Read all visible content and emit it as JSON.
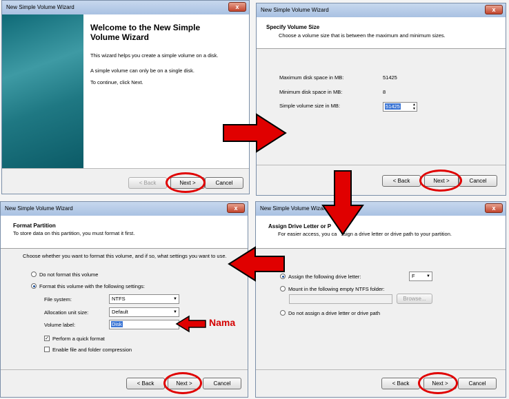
{
  "colors": {
    "accent_red": "#e00000",
    "sidebar_teal": "#2a7f8a",
    "titlebar": "#b4c9e6"
  },
  "welcome": {
    "window_title": "New Simple Volume Wizard",
    "close_glyph": "x",
    "heading": "Welcome to the New Simple Volume Wizard",
    "line1": "This wizard helps you create a simple volume on a disk.",
    "line2": "A simple volume can only be on a single disk.",
    "line3": "To continue, click Next.",
    "back": "< Back",
    "next": "Next >",
    "cancel": "Cancel"
  },
  "size": {
    "window_title": "New Simple Volume Wizard",
    "close_glyph": "x",
    "title": "Specify Volume Size",
    "subtitle": "Choose a volume size that is between the maximum and minimum sizes.",
    "max_label": "Maximum disk space in MB:",
    "max_value": "51425",
    "min_label": "Minimum disk space in MB:",
    "min_value": "8",
    "size_label": "Simple volume size in MB:",
    "size_value": "51425",
    "back": "< Back",
    "next": "Next >",
    "cancel": "Cancel"
  },
  "format": {
    "window_title": "New Simple Volume Wizard",
    "close_glyph": "x",
    "title": "Format Partition",
    "subtitle": "To store data on this partition, you must format it first.",
    "intro": "Choose whether you want to format this volume, and if so, what settings you want to use.",
    "opt_no": "Do not format this volume",
    "opt_yes": "Format this volume with the following settings:",
    "fs_label": "File system:",
    "fs_value": "NTFS",
    "alloc_label": "Allocation unit size:",
    "alloc_value": "Default",
    "label_label": "Volume label:",
    "label_value": "Disk",
    "quick": "Perform a quick format",
    "compress": "Enable file and folder compression",
    "back": "< Back",
    "next": "Next >",
    "cancel": "Cancel",
    "annotation": "Nama"
  },
  "letter": {
    "window_title": "New Simple Volume Wizard",
    "close_glyph": "x",
    "title": "Assign Drive Letter or P",
    "subtitle_a": "For easier access, you ca",
    "subtitle_b": "ssign a drive letter or drive path to your partition.",
    "opt_assign": "Assign the following drive letter:",
    "drive": "F",
    "opt_mount": "Mount in the following empty NTFS folder:",
    "browse": "Browse...",
    "opt_none": "Do not assign a drive letter or drive path",
    "back": "< Back",
    "next": "Next >",
    "cancel": "Cancel"
  }
}
